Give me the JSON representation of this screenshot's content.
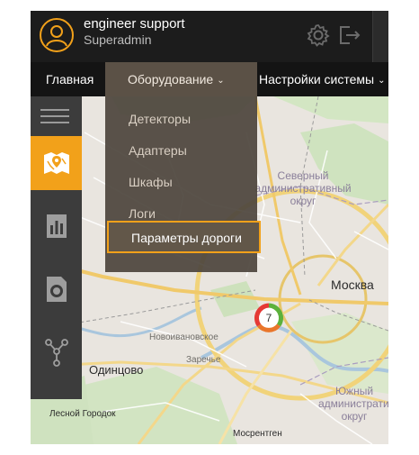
{
  "header": {
    "user_name": "engineer support",
    "user_role": "Superadmin",
    "icons": [
      "user-avatar-icon",
      "gear-icon",
      "logout-icon"
    ]
  },
  "menubar": {
    "home": "Главная",
    "equipment": "Оборудование",
    "settings": "Настройки системы",
    "caret": "⌄"
  },
  "dropdown": {
    "items": [
      "Детекторы",
      "Адаптеры",
      "Шкафы",
      "Логи"
    ],
    "highlighted": "Параметры дороги"
  },
  "sidebar": {
    "items": [
      "map-icon",
      "chart-icon",
      "storage-icon",
      "network-icon"
    ],
    "active": "map-icon"
  },
  "map": {
    "city": "Москва",
    "district_north": "Северный административный округ",
    "district_south": "Южный административный округ",
    "labels": [
      "Новоивановское",
      "Заречье",
      "Одинцово",
      "Лесной Городок",
      "Мосрентген"
    ],
    "cluster_count": "7"
  },
  "colors": {
    "accent": "#f2a11a",
    "header_bg": "#1c1c1c",
    "menubar_bg": "#141414",
    "sidebar_bg": "#3c3c3c",
    "dropdown_bg": "#4e463d"
  }
}
